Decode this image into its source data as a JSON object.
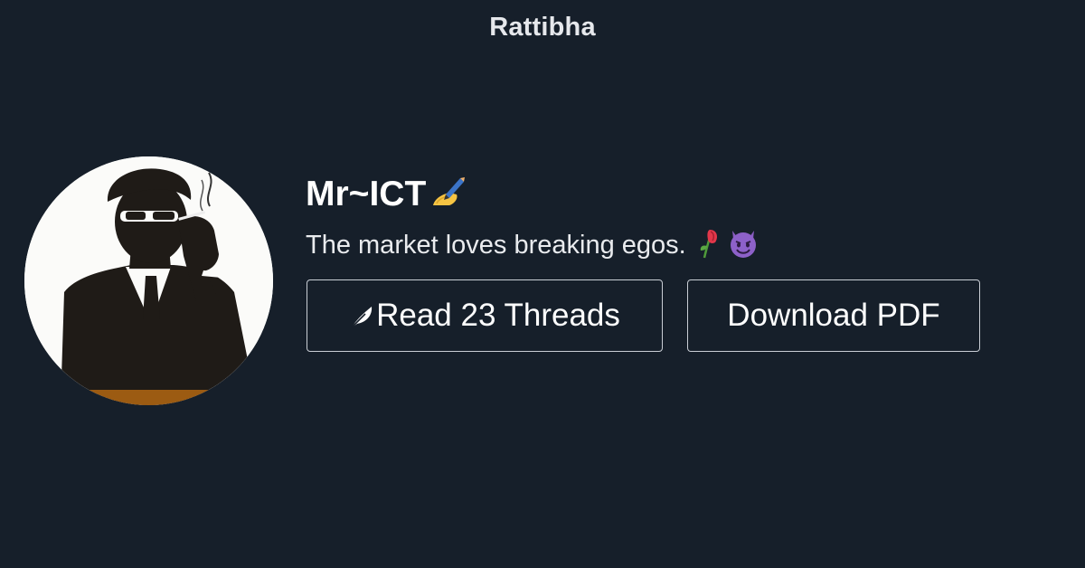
{
  "header": {
    "brand": "Rattibha"
  },
  "profile": {
    "display_name": "Mr~ICT",
    "name_icon": "writing-hand-icon",
    "bio": "The market loves breaking egos.",
    "bio_icons": [
      "wilted-rose-icon",
      "smiling-devil-icon"
    ],
    "avatar_icon": "smoking-man-silhouette-avatar"
  },
  "actions": {
    "read_threads_label": "Read 23 Threads",
    "read_threads_icon": "feather-icon",
    "download_pdf_label": "Download PDF"
  },
  "colors": {
    "background": "#161f2a",
    "button_border": "#c9ced5",
    "text": "#ffffff"
  }
}
